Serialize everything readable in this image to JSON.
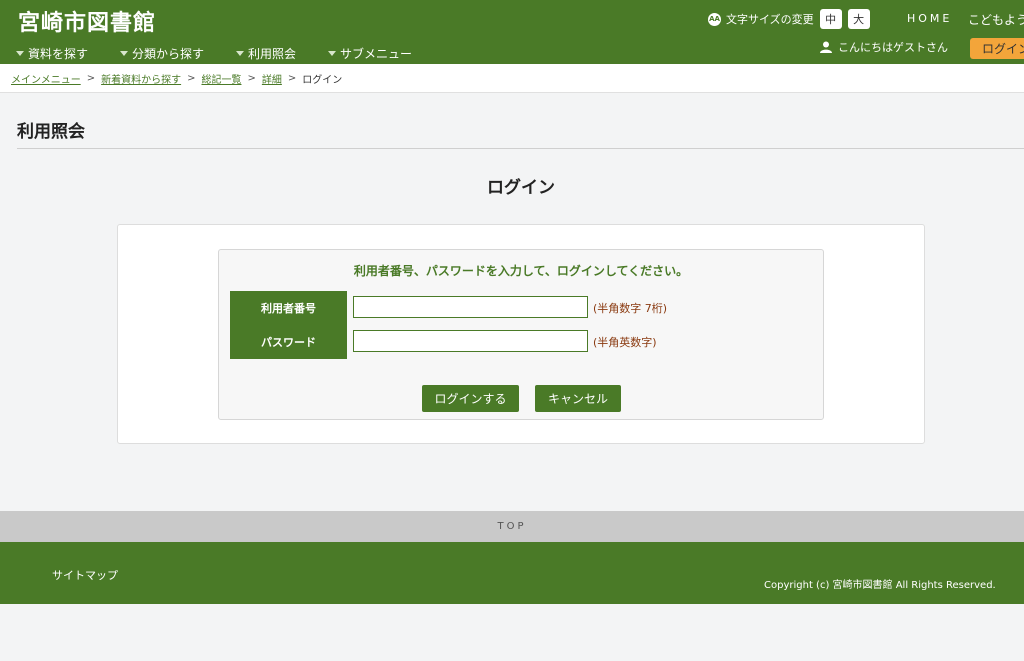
{
  "header": {
    "logo": "宮崎市図書館",
    "font_size_label": "文字サイズの変更",
    "font_size_icon": "AA",
    "font_sizes": [
      "中",
      "大"
    ],
    "home": "HOME",
    "kids": "こどもよう",
    "greeting": "こんにちはゲストさん",
    "login_button": "ログイン",
    "nav": [
      "資料を探す",
      "分類から探す",
      "利用照会",
      "サブメニュー"
    ]
  },
  "breadcrumb": {
    "items": [
      "メインメニュー",
      "新着資料から探す",
      "総記一覧",
      "詳細"
    ],
    "current": "ログイン",
    "separator": ">"
  },
  "page": {
    "title": "利用照会",
    "heading": "ログイン",
    "instruction": "利用者番号、パスワードを入力して、ログインしてください。",
    "user_label": "利用者番号",
    "user_value": "",
    "user_hint": "(半角数字 7桁)",
    "password_label": "パスワード",
    "password_value": "",
    "password_hint": "(半角英数字)",
    "login_submit": "ログインする",
    "cancel": "キャンセル"
  },
  "footer": {
    "top": "TOP",
    "sitemap": "サイトマップ",
    "copyright": "Copyright (c) 宮崎市図書館 All Rights Reserved."
  },
  "colors": {
    "brand_green": "#4a7a27",
    "accent_orange": "#f3a53a",
    "hint_brown": "#8a3a10"
  }
}
